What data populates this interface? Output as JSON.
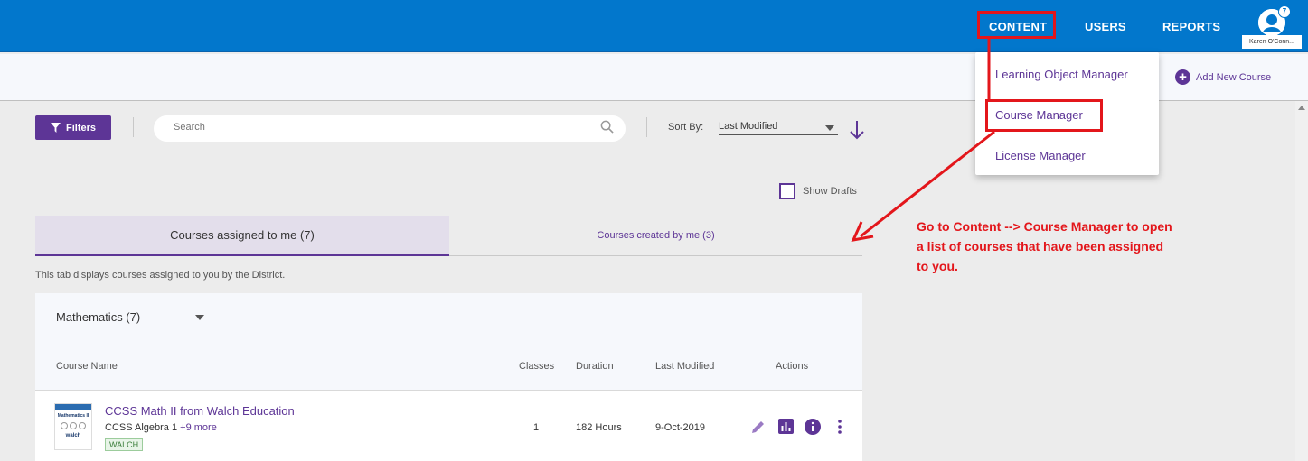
{
  "nav": {
    "items": [
      "CONTENT",
      "USERS",
      "REPORTS"
    ],
    "user_badge": "7",
    "user_name": "Karen O'Conn..."
  },
  "toolbar": {
    "add_course": "Add New Course"
  },
  "dropdown": {
    "items": [
      "Learning Object Manager",
      "Course Manager",
      "License Manager"
    ]
  },
  "filters": {
    "button_label": "Filters",
    "search_placeholder": "Search",
    "sort_label": "Sort By:",
    "sort_value": "Last Modified",
    "show_drafts": "Show Drafts"
  },
  "tabs": {
    "assigned": "Courses assigned to me (7)",
    "created": "Courses created by me (3)",
    "description": "This tab displays courses assigned to you by the District."
  },
  "table": {
    "subject": "Mathematics (7)",
    "columns": [
      "Course Name",
      "Classes",
      "Duration",
      "Last Modified",
      "Actions"
    ],
    "rows": [
      {
        "title": "CCSS Math II from Walch Education",
        "standard": "CCSS Algebra 1",
        "more": "+9 more",
        "tag": "WALCH",
        "classes": "1",
        "duration": "182 Hours",
        "last_modified": "9-Oct-2019",
        "thumb_title": "Mathematics II",
        "thumb_brand": "walch"
      }
    ]
  },
  "annotation": {
    "text": "Go to Content --> Course Manager to open a list of courses that have been assigned to you."
  },
  "colors": {
    "topbar": "#0277cc",
    "accent": "#5d3596",
    "highlight": "#e3161b"
  }
}
